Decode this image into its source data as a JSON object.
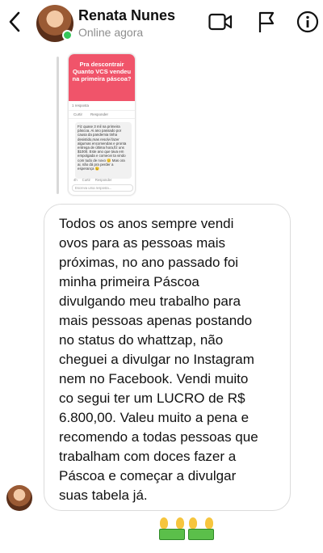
{
  "header": {
    "contact_name": "Renata Nunes",
    "status": "Online agora",
    "icons": [
      "chevron-left-icon",
      "video-camera-icon",
      "flag-icon",
      "info-icon"
    ],
    "online_color": "#35c759"
  },
  "shared_image": {
    "headline": "Pra descontrair Quanto VCS vendeu na primeira páscoa?",
    "replies": "1 resposta",
    "actions": [
      "Curtir",
      "Responder"
    ],
    "comment": "Fiz quase 3 mil na primeira páscoa. Ai ano passado por causa da pandemia tinha desistido,mas resolvi fazer algumas encomendas e pronta entrega de última hora,fiz uns $1000. Este ano que tava em empolgada e comecei ta vindo com tudo de novo 😊 Mas ora ai, não dá pra perder a esperança 😉",
    "comment_meta": [
      "4h",
      "Curtir",
      "Responder"
    ],
    "input_placeholder": "Escreva uma resposta...",
    "accent_color": "#f0546a"
  },
  "message": {
    "text": "Todos os anos sempre vendi\novos para as pessoas mais\npróximas, no ano passado foi\nminha primeira Páscoa\ndivulgando meu trabalho para\nmais pessoas apenas postando\nno status do whattzap, não\ncheguei a divulgar no Instagram\nnem no Facebook. Vendi muito\nco segui ter um LUCRO de R$\n6.800,00. Valeu muito a pena e\nrecomendo a todas pessoas que\ntrabalham com doces fazer a\nPáscoa e começar a divulgar\nsuas tabela já."
  },
  "reaction": {
    "emoji": [
      "money-with-wings-icon",
      "money-with-wings-icon"
    ]
  }
}
